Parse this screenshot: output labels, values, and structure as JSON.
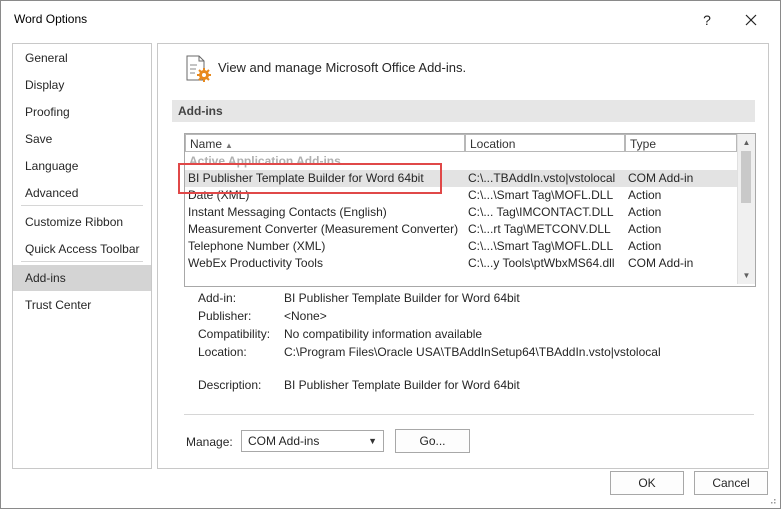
{
  "window": {
    "title": "Word Options",
    "help_glyph": "?"
  },
  "nav": {
    "items": [
      {
        "label": "General"
      },
      {
        "label": "Display"
      },
      {
        "label": "Proofing"
      },
      {
        "label": "Save"
      },
      {
        "label": "Language"
      },
      {
        "label": "Advanced"
      },
      {
        "label": "Customize Ribbon"
      },
      {
        "label": "Quick Access Toolbar"
      },
      {
        "label": "Add-ins",
        "selected": true
      },
      {
        "label": "Trust Center"
      }
    ]
  },
  "main": {
    "header": "View and manage Microsoft Office Add-ins.",
    "section_title": "Add-ins",
    "columns": {
      "name": "Name",
      "location": "Location",
      "type": "Type"
    },
    "group_label": "Active Application Add-ins",
    "rows": [
      {
        "name": "BI Publisher Template Builder for Word 64bit",
        "location": "C:\\...TBAddIn.vsto|vstolocal",
        "type": "COM Add-in",
        "selected": true
      },
      {
        "name": "Date (XML)",
        "location": "C:\\...\\Smart Tag\\MOFL.DLL",
        "type": "Action"
      },
      {
        "name": "Instant Messaging Contacts (English)",
        "location": "C:\\... Tag\\IMCONTACT.DLL",
        "type": "Action"
      },
      {
        "name": "Measurement Converter (Measurement Converter)",
        "location": "C:\\...rt Tag\\METCONV.DLL",
        "type": "Action"
      },
      {
        "name": "Telephone Number (XML)",
        "location": "C:\\...\\Smart Tag\\MOFL.DLL",
        "type": "Action"
      },
      {
        "name": "WebEx Productivity Tools",
        "location": "C:\\...y Tools\\ptWbxMS64.dll",
        "type": "COM Add-in"
      }
    ],
    "details": {
      "addin_label": "Add-in:",
      "addin": "BI Publisher Template Builder for Word 64bit",
      "publisher_label": "Publisher:",
      "publisher": "<None>",
      "compatibility_label": "Compatibility:",
      "compatibility": "No compatibility information available",
      "location_label": "Location:",
      "location": "C:\\Program Files\\Oracle USA\\TBAddInSetup64\\TBAddIn.vsto|vstolocal",
      "description_label": "Description:",
      "description": "BI Publisher Template Builder for Word 64bit"
    },
    "manage": {
      "label": "Manage:",
      "value": "COM Add-ins",
      "go_label": "Go..."
    }
  },
  "footer": {
    "ok_label": "OK",
    "cancel_label": "Cancel"
  },
  "colors": {
    "highlight_border": "#e04848",
    "selected_nav": "#d4d4d4",
    "icon_accent": "#e8891d"
  },
  "icons": [
    "close-icon",
    "addins-gear-icon",
    "sort-up-icon",
    "scroll-up-icon",
    "scroll-down-icon",
    "dropdown-caret-icon",
    "resize-grip-icon"
  ]
}
